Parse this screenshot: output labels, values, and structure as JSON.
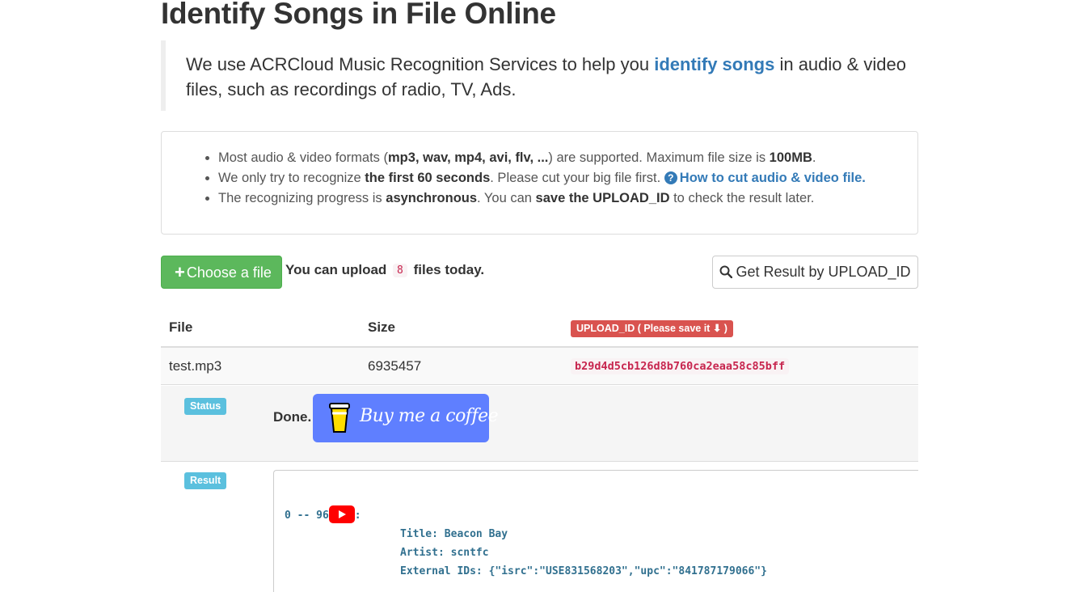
{
  "page": {
    "title": "Identify Songs in File Online"
  },
  "intro": {
    "before": "We use ACRCloud Music Recognition Services to help you ",
    "link": "identify songs",
    "after": " in audio & video files, such as recordings of radio, TV, Ads."
  },
  "info": {
    "item1": {
      "a": "Most audio & video formats (",
      "b": "mp3, wav, mp4, avi, flv, ...",
      "c": ") are supported. Maximum file size is ",
      "d": "100MB",
      "e": "."
    },
    "item2": {
      "a": "We only try to recognize ",
      "b": "the first 60 seconds",
      "c": ". Please cut your big file first. ",
      "link": "How to cut audio & video file."
    },
    "item3": {
      "a": "The recognizing progress is ",
      "b": "asynchronous",
      "c": ". You can ",
      "d": "save the UPLOAD_ID",
      "e": " to check the result later."
    }
  },
  "actions": {
    "choose_file": "Choose a file",
    "upload_note_before": "You can upload",
    "upload_count": "8",
    "upload_note_after": "files today.",
    "get_result": "Get Result by UPLOAD_ID"
  },
  "table": {
    "headers": {
      "file": "File",
      "size": "Size",
      "upload_id": "UPLOAD_ID ( Please save it ⬇ )"
    },
    "row": {
      "file": "test.mp3",
      "size": "6935457",
      "upload_id": "b29d4d5cb126d8b760ca2eaa58c85bff"
    },
    "status_badge": "Status",
    "status_text": "Done.",
    "bmc_label": "Buy me a coffee",
    "result_badge": "Result"
  },
  "result": {
    "segment_start": "0 -- 96",
    "segment_end": ":",
    "title": "Title: Beacon Bay",
    "artist": "Artist: scntfc",
    "external_ids": "External IDs: {\"isrc\":\"USE831568203\",\"upc\":\"841787179066\"}"
  },
  "colors": {
    "success": "#5cb85c",
    "danger": "#d9534f",
    "info": "#5bc0de",
    "link": "#337ab7",
    "bmc": "#5f7fff",
    "youtube": "#ff0000"
  },
  "icons": {
    "plus": "plus-icon",
    "search": "search-icon",
    "help": "question-circle-icon",
    "arrow": "arrow-down-icon",
    "cup": "coffee-cup-icon",
    "youtube": "youtube-icon"
  }
}
